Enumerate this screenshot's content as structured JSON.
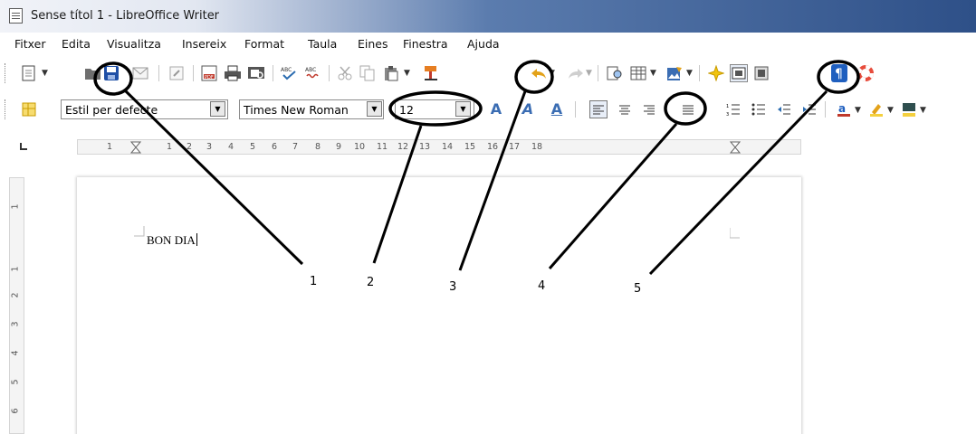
{
  "window": {
    "title": "Sense títol 1 - LibreOffice Writer"
  },
  "menubar": {
    "items": [
      {
        "label": "Fitxer"
      },
      {
        "label": "Edita"
      },
      {
        "label": "Visualitza"
      },
      {
        "label": "Insereix"
      },
      {
        "label": "Format"
      },
      {
        "label": "Taula"
      },
      {
        "label": "Eines"
      },
      {
        "label": "Finestra"
      },
      {
        "label": "Ajuda"
      }
    ]
  },
  "formatting": {
    "paragraph_style": "Estil per defecte",
    "font_name": "Times New Roman",
    "font_size": "12"
  },
  "ruler": {
    "horizontal_ticks": [
      "1",
      "2",
      "3",
      "4",
      "5",
      "6",
      "7",
      "8",
      "9",
      "10",
      "11",
      "12",
      "13",
      "14",
      "15",
      "16",
      "17",
      "18"
    ],
    "vertical_ticks": [
      "1",
      "1",
      "2",
      "3",
      "4",
      "5",
      "6"
    ]
  },
  "document": {
    "text": "BON DIA"
  },
  "annotations": {
    "labels": [
      "1",
      "2",
      "3",
      "4",
      "5"
    ]
  },
  "colors": {
    "titlebar_end": "#2e5088",
    "save_icon": "#1f4fa6",
    "undo_icon": "#e3a21a",
    "pilcrow_icon": "#1f5fbf",
    "highlight_icon": "#f4d03f",
    "annotation": "#000000"
  }
}
